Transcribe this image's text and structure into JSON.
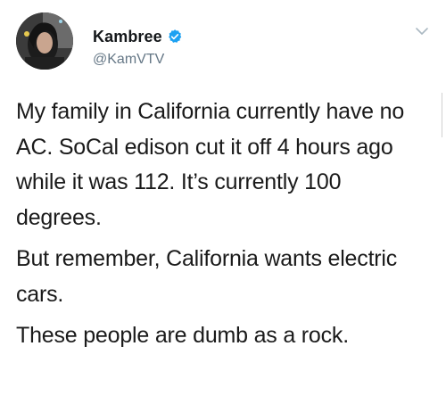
{
  "tweet": {
    "display_name": "Kambree",
    "handle": "@KamVTV",
    "verified": true,
    "avatar_icon": "user-avatar-photo",
    "menu_icon": "chevron-down-icon",
    "paragraphs": [
      "My family in California currently have no AC. SoCal edison cut it off 4 hours ago while it was 112. It’s currently 100 degrees.",
      "But remember, California wants electric cars.",
      "These people are dumb as a rock."
    ]
  },
  "colors": {
    "verified_badge": "#1da1f2",
    "handle_text": "#657786",
    "body_text": "#1a1a1a"
  }
}
